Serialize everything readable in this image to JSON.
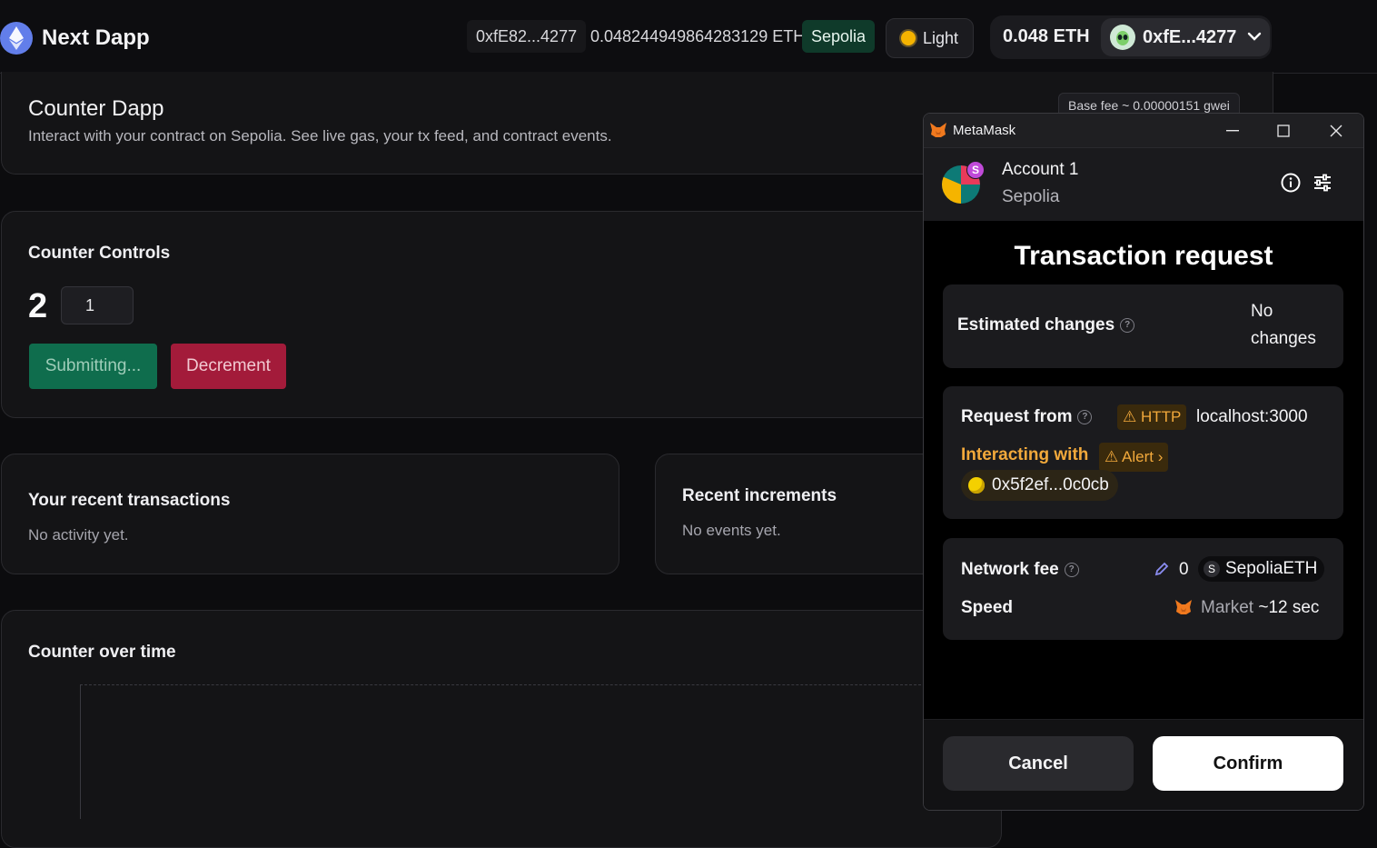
{
  "nav": {
    "brand": "Next Dapp",
    "address_chip": "0xfE82...4277",
    "balance_text": "0.048244949864283129 ETH",
    "network_chip": "Sepolia",
    "theme_button": "Light",
    "account_balance": "0.048 ETH",
    "account_address": "0xfE...4277"
  },
  "header_card": {
    "title": "Counter Dapp",
    "subtitle": "Interact with your contract on Sepolia. See live gas, your tx feed, and contract events.",
    "base_fee": "Base fee ~ 0.00000151 gwei"
  },
  "controls": {
    "title": "Counter Controls",
    "counter_value": "2",
    "step_value": "1",
    "submit_label": "Submitting...",
    "decrement_label": "Decrement"
  },
  "transactions": {
    "title": "Your recent transactions",
    "empty": "No activity yet."
  },
  "increments": {
    "title": "Recent increments",
    "empty": "No events yet."
  },
  "chart_section": {
    "title": "Counter over time"
  },
  "metamask": {
    "window_title": "MetaMask",
    "account": "Account 1",
    "network": "Sepolia",
    "badge": "S",
    "heading": "Transaction request",
    "estimated_changes_label": "Estimated changes",
    "estimated_changes_value_1": "No",
    "estimated_changes_value_2": "changes",
    "request_from_label": "Request from",
    "http_chip": "HTTP",
    "request_from_value": "localhost:3000",
    "interacting_label": "Interacting with",
    "alert_chip": "Alert",
    "contract_address": "0x5f2ef...0c0cb",
    "network_fee_label": "Network fee",
    "network_fee_value": "0",
    "fee_token_badge": "S",
    "fee_token": "SepoliaETH",
    "speed_label": "Speed",
    "speed_market": "Market",
    "speed_time": "~12 sec",
    "cancel_label": "Cancel",
    "confirm_label": "Confirm"
  },
  "colors": {
    "accent_green": "#0f6d4d",
    "accent_red": "#a31b3a",
    "warning_orange": "#f2a93b",
    "eth_blue": "#627eea"
  }
}
